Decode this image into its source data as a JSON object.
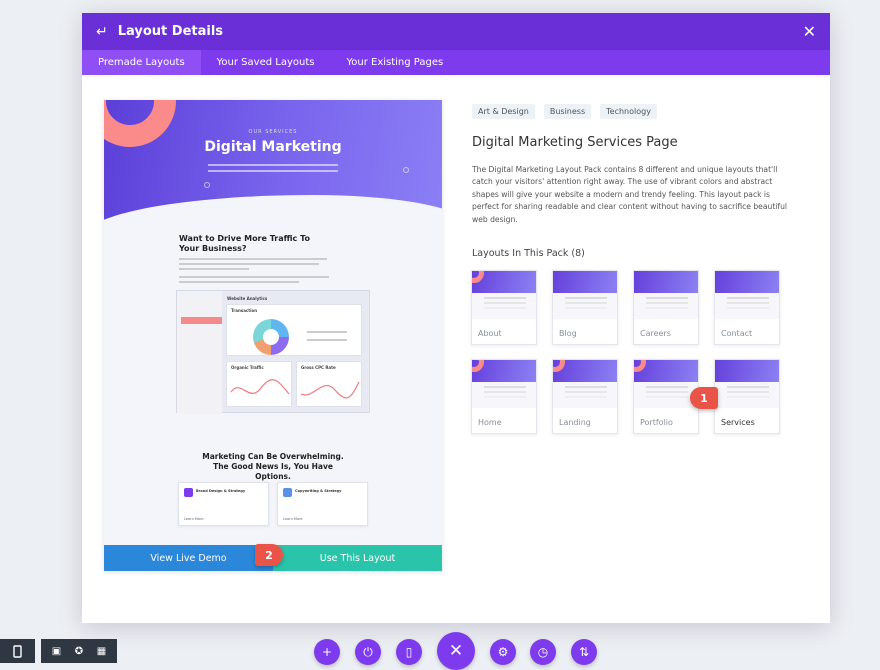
{
  "modal": {
    "title": "Layout Details",
    "back_icon": "return-arrow-icon",
    "close_icon": "close-icon",
    "tabs": [
      {
        "label": "Premade Layouts",
        "active": true
      },
      {
        "label": "Your Saved Layouts",
        "active": false
      },
      {
        "label": "Your Existing Pages",
        "active": false
      }
    ]
  },
  "preview": {
    "hero_tag": "OUR SERVICES",
    "hero_title": "Digital Marketing",
    "section_title": "Want to Drive More Traffic To Your Business?",
    "dashboard_title": "Website Analytics",
    "dashboard_panel": "Transaction",
    "card_organic": "Organic Traffic",
    "card_cpc": "Gross CPC Rate",
    "section2_title": "Marketing Can Be Overwhelming. The Good News Is, You Have Options.",
    "feature1": "Brand Design & Strategy",
    "feature2": "Copywriting & Strategy",
    "learn_more": "Learn More",
    "demo_button": "View Live Demo",
    "use_button": "Use This Layout"
  },
  "info": {
    "tags": [
      "Art & Design",
      "Business",
      "Technology"
    ],
    "title": "Digital Marketing Services Page",
    "description": "The Digital Marketing Layout Pack contains 8 different and unique layouts that'll catch your visitors' attention right away. The use of vibrant colors and abstract shapes will give your website a modern and trendy feeling. This layout pack is perfect for sharing readable and clear content without having to sacrifice beautiful web design.",
    "pack_heading": "Layouts In This Pack (8)",
    "layouts": [
      "About",
      "Blog",
      "Careers",
      "Contact",
      "Home",
      "Landing",
      "Portfolio",
      "Services"
    ],
    "selected_layout": "Services"
  },
  "annotations": {
    "step1": "1",
    "step2": "2"
  },
  "toolbar": {
    "left_icons": [
      "mobile-view-icon",
      "wireframe-icon",
      "hover-icon",
      "grid-icon"
    ],
    "buttons": [
      "add-icon",
      "power-icon",
      "trash-icon",
      "close-icon",
      "settings-icon",
      "history-icon",
      "sort-icon"
    ]
  },
  "colors": {
    "accent": "#7e3bed",
    "header": "#6a2fd6",
    "demo": "#2b87da",
    "use": "#29c4a9",
    "badge": "#ea5448"
  }
}
